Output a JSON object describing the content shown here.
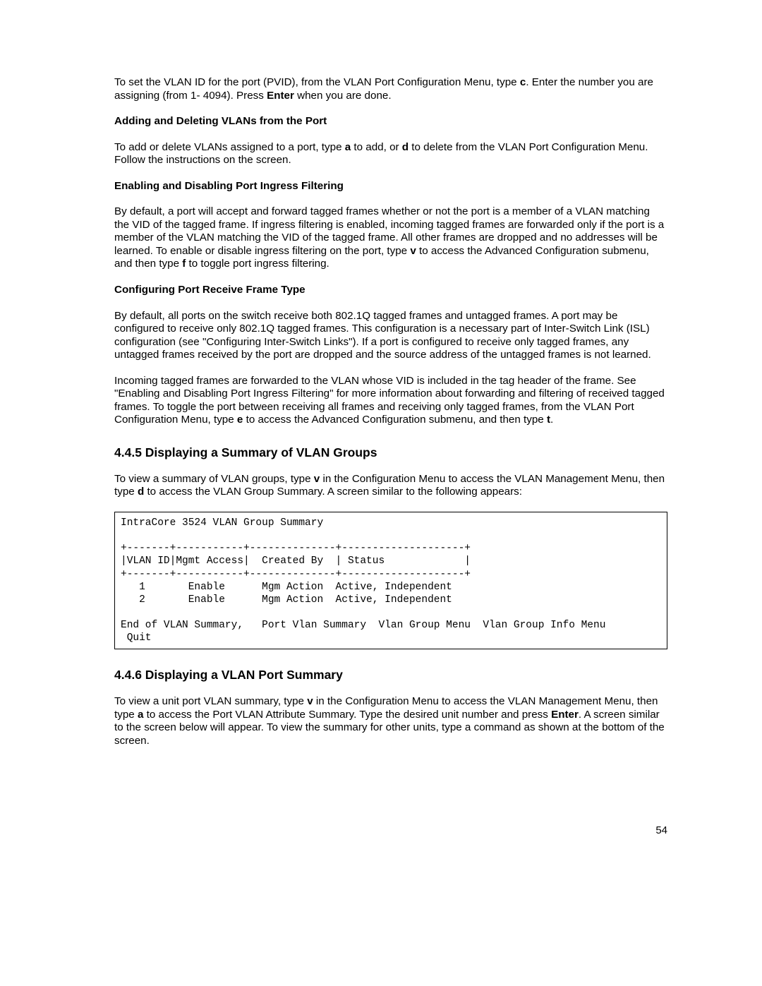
{
  "p1_a": "To set the VLAN ID for the port (PVID), from the VLAN Port Configuration Menu, type ",
  "p1_b": ". Enter the number you are assigning (from 1- 4094). Press ",
  "p1_c": " when you are done.",
  "key_c": "c",
  "key_enter": "Enter",
  "h_add": "Adding and Deleting VLANs from the Port",
  "p2_a": "To add or delete VLANs assigned to a port, type ",
  "p2_b": " to add, or ",
  "p2_c": " to delete from the VLAN Port Configuration Menu. Follow the instructions on the screen.",
  "key_a": "a",
  "key_d": "d",
  "h_ingress": "Enabling and Disabling Port Ingress Filtering",
  "p3_a": "By default, a port will accept and forward tagged frames whether or not the port is a member of a VLAN matching the VID of the tagged frame.  If ingress filtering is enabled, incoming tagged frames are forwarded only if the port is a member of the VLAN matching the VID of the tagged frame. All other frames are dropped and no addresses will be learned.  To enable or disable ingress filtering on the port, type ",
  "p3_b": " to access the Advanced Configuration submenu, and then type ",
  "p3_c": " to toggle port ingress filtering.",
  "key_v": "v",
  "key_f": "f",
  "h_frametype": "Configuring Port Receive Frame Type",
  "p4": "By default, all ports on the switch receive both 802.1Q tagged frames and untagged frames. A port may be configured to receive only 802.1Q tagged frames. This configuration is a necessary part of Inter-Switch Link (ISL) configuration (see \"Configuring Inter-Switch Links\").  If a port is configured to receive only tagged frames, any untagged frames received by the port are dropped and the source address of the untagged frames is not learned.",
  "p5_a": "Incoming tagged frames are forwarded to the VLAN whose VID is included in the tag header of the frame. See \"Enabling and Disabling Port Ingress Filtering\" for more information about forwarding and filtering of received tagged frames.  To toggle the port between receiving all frames and receiving only tagged frames, from the VLAN Port Configuration Menu, type ",
  "p5_b": " to access the Advanced Configuration submenu, and then type ",
  "p5_c": ".",
  "key_e": "e",
  "key_t": "t",
  "sec_445": "4.4.5 Displaying a Summary of VLAN Groups",
  "p6_a": "To view a summary of VLAN groups, type ",
  "p6_b": " in the Configuration Menu to access the VLAN Management Menu, then type ",
  "p6_c": " to access the VLAN Group Summary. A screen similar to the following appears:",
  "code": "IntraCore 3524 VLAN Group Summary\n\n+-------+-----------+--------------+--------------------+\n|VLAN ID|Mgmt Access|  Created By  | Status             |\n+-------+-----------+--------------+--------------------+\n   1       Enable      Mgm Action  Active, Independent\n   2       Enable      Mgm Action  Active, Independent\n\nEnd of VLAN Summary,   Port Vlan Summary  Vlan Group Menu  Vlan Group Info Menu\n Quit",
  "sec_446": "4.4.6 Displaying a VLAN Port Summary",
  "p7_a": "To view a unit port VLAN summary, type ",
  "p7_b": " in the Configuration Menu to access the VLAN Management Menu, then type ",
  "p7_c": " to access the Port VLAN Attribute Summary. Type the desired unit number and press ",
  "p7_d": ". A screen similar to the screen below will appear.  To view the summary for other units, type a command as shown at the bottom of the screen.",
  "pagenum": "54"
}
